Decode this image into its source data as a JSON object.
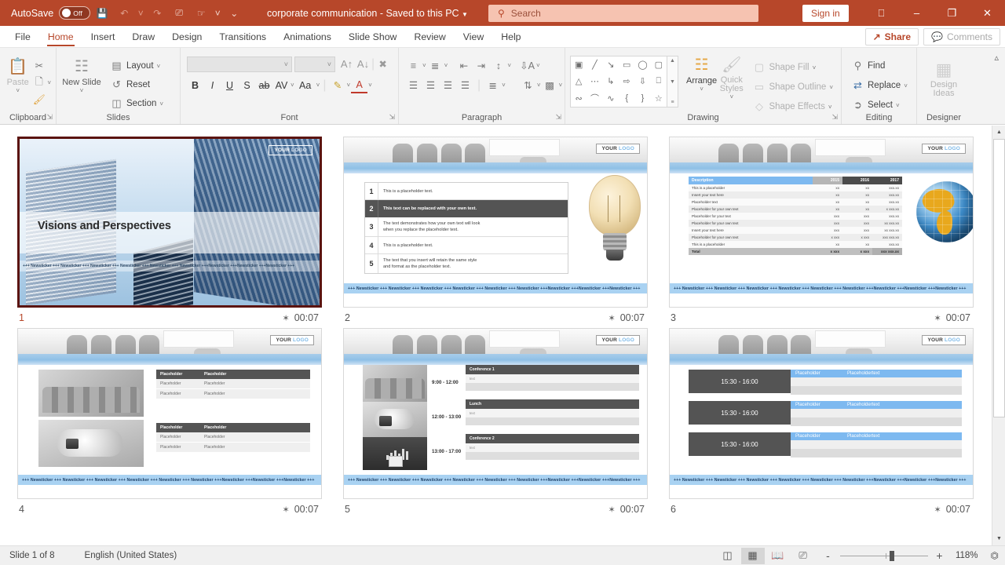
{
  "titlebar": {
    "autosave_label": "AutoSave",
    "autosave_state": "Off",
    "document_title": "corporate communication  -  Saved to this PC",
    "quick_access": [
      "save-icon",
      "undo-icon",
      "redo-icon",
      "start-presentation-icon",
      "touch-mode-icon",
      "customize-qat-icon"
    ],
    "signin_label": "Sign in",
    "window_buttons": [
      "restore-up-icon",
      "minimize",
      "maximize",
      "close"
    ],
    "accent_color": "#b7472a"
  },
  "search": {
    "placeholder": "Search",
    "value": ""
  },
  "tabs": [
    {
      "label": "File",
      "active": false
    },
    {
      "label": "Home",
      "active": true
    },
    {
      "label": "Insert",
      "active": false
    },
    {
      "label": "Draw",
      "active": false
    },
    {
      "label": "Design",
      "active": false
    },
    {
      "label": "Transitions",
      "active": false
    },
    {
      "label": "Animations",
      "active": false
    },
    {
      "label": "Slide Show",
      "active": false
    },
    {
      "label": "Review",
      "active": false
    },
    {
      "label": "View",
      "active": false
    },
    {
      "label": "Help",
      "active": false
    }
  ],
  "tabbar_right": {
    "share_label": "Share",
    "comments_label": "Comments"
  },
  "ribbon": {
    "groups": [
      {
        "name": "Clipboard",
        "label": "Clipboard",
        "has_dialog": true,
        "items": [
          {
            "label": "Paste",
            "icon": "paste-icon",
            "disabled": true
          },
          {
            "label": "Cut",
            "icon": "scissors-icon",
            "disabled": false
          },
          {
            "label": "Copy",
            "icon": "copy-icon",
            "disabled": false
          },
          {
            "label": "Format Painter",
            "icon": "format-painter-icon",
            "disabled": false
          }
        ]
      },
      {
        "name": "Slides",
        "label": "Slides",
        "has_dialog": false,
        "items": [
          {
            "label": "New Slide",
            "icon": "new-slide-icon",
            "disabled": false
          },
          {
            "label": "Layout",
            "icon": "layout-icon",
            "disabled": false
          },
          {
            "label": "Reset",
            "icon": "reset-icon",
            "disabled": false
          },
          {
            "label": "Section",
            "icon": "section-icon",
            "disabled": false
          }
        ]
      },
      {
        "name": "Font",
        "label": "Font",
        "has_dialog": true,
        "font_name": "",
        "font_size": "",
        "items": [
          {
            "label": "Bold",
            "icon": "bold-icon"
          },
          {
            "label": "Italic",
            "icon": "italic-icon"
          },
          {
            "label": "Underline",
            "icon": "underline-icon"
          },
          {
            "label": "Text Shadow",
            "icon": "shadow-icon"
          },
          {
            "label": "Strikethrough",
            "icon": "strikethrough-icon"
          },
          {
            "label": "Character Spacing",
            "icon": "char-spacing-icon"
          },
          {
            "label": "Change Case",
            "icon": "change-case-icon"
          },
          {
            "label": "Text Highlight Color",
            "icon": "highlight-icon"
          },
          {
            "label": "Font Color",
            "icon": "font-color-icon"
          },
          {
            "label": "Increase Font Size",
            "icon": "increase-font-icon"
          },
          {
            "label": "Decrease Font Size",
            "icon": "decrease-font-icon"
          },
          {
            "label": "Clear All Formatting",
            "icon": "clear-formatting-icon"
          }
        ]
      },
      {
        "name": "Paragraph",
        "label": "Paragraph",
        "has_dialog": true,
        "items": [
          {
            "label": "Bullets",
            "icon": "bullets-icon"
          },
          {
            "label": "Numbering",
            "icon": "numbering-icon"
          },
          {
            "label": "Decrease Indent",
            "icon": "decrease-indent-icon"
          },
          {
            "label": "Increase Indent",
            "icon": "increase-indent-icon"
          },
          {
            "label": "Line Spacing",
            "icon": "line-spacing-icon"
          },
          {
            "label": "Align Left",
            "icon": "align-left-icon"
          },
          {
            "label": "Center",
            "icon": "align-center-icon"
          },
          {
            "label": "Align Right",
            "icon": "align-right-icon"
          },
          {
            "label": "Justify",
            "icon": "justify-icon"
          },
          {
            "label": "Columns",
            "icon": "columns-icon"
          },
          {
            "label": "Text Direction",
            "icon": "text-direction-icon"
          },
          {
            "label": "Align Text",
            "icon": "align-text-icon"
          },
          {
            "label": "Convert to SmartArt",
            "icon": "smartart-icon"
          }
        ]
      },
      {
        "name": "Drawing",
        "label": "Drawing",
        "has_dialog": true,
        "items": [
          {
            "label": "Arrange",
            "icon": "arrange-icon",
            "disabled": false
          },
          {
            "label": "Quick Styles",
            "icon": "quick-styles-icon",
            "disabled": true
          },
          {
            "label": "Shape Fill",
            "icon": "shape-fill-icon",
            "disabled": true
          },
          {
            "label": "Shape Outline",
            "icon": "shape-outline-icon",
            "disabled": true
          },
          {
            "label": "Shape Effects",
            "icon": "shape-effects-icon",
            "disabled": true
          }
        ]
      },
      {
        "name": "Editing",
        "label": "Editing",
        "has_dialog": false,
        "items": [
          {
            "label": "Find",
            "icon": "search-icon"
          },
          {
            "label": "Replace",
            "icon": "replace-icon"
          },
          {
            "label": "Select",
            "icon": "select-pointer-icon"
          }
        ]
      },
      {
        "name": "Designer",
        "label": "Designer",
        "has_dialog": false,
        "items": [
          {
            "label": "Design Ideas",
            "icon": "design-ideas-icon",
            "disabled": true
          }
        ]
      }
    ],
    "shape_gallery": [
      "textbox",
      "line",
      "line-arrow",
      "rectangle",
      "oval",
      "rounded-rectangle",
      "triangle",
      "elbow-connector",
      "elbow-arrow-connector",
      "block-arrow-right",
      "block-arrow-down",
      "flowchart-shape",
      "scribble",
      "arc",
      "curve",
      "left-brace",
      "right-brace",
      "star"
    ],
    "collapse_label": "Collapse the Ribbon"
  },
  "slides": [
    {
      "number": "1",
      "timing": "00:07",
      "selected": true,
      "logo": {
        "first": "YOUR",
        "second": "LOGO"
      },
      "title": "Visions and Perspectives",
      "ticker": "+++ Newsticker +++ Newsticker +++ Newsticker +++ Newsticker +++ Newsticker +++ Newsticker +++Newsticker +++Newsticker +++Newsticker +++"
    },
    {
      "number": "2",
      "timing": "00:07",
      "selected": false,
      "logo": {
        "first": "YOUR",
        "second": "LOGO"
      },
      "ticker": "+++ Newsticker +++ Newsticker +++ Newsticker +++ Newsticker +++ Newsticker +++ Newsticker +++Newsticker +++Newsticker +++Newsticker +++",
      "list": [
        {
          "n": "1",
          "lines": [
            "This is a placeholder text."
          ],
          "highlight": false
        },
        {
          "n": "2",
          "lines": [
            "This text can be replaced with your own text."
          ],
          "highlight": true
        },
        {
          "n": "3",
          "lines": [
            "The text demonstrates how your own text will look",
            "when you replace the placeholder text."
          ],
          "highlight": false
        },
        {
          "n": "4",
          "lines": [
            "This is a placeholder text."
          ],
          "highlight": false
        },
        {
          "n": "5",
          "lines": [
            "The text that you insert will retain the same style",
            "and format as the placeholder text."
          ],
          "highlight": false
        }
      ]
    },
    {
      "number": "3",
      "timing": "00:07",
      "selected": false,
      "logo": {
        "first": "YOUR",
        "second": "LOGO"
      },
      "ticker": "+++ Newsticker +++ Newsticker +++ Newsticker +++ Newsticker +++ Newsticker +++ Newsticker +++Newsticker +++Newsticker +++Newsticker +++",
      "table": {
        "headers": [
          "Description",
          "2015",
          "2016",
          "2017"
        ],
        "rows": [
          {
            "label": "This is a placeholder",
            "values": [
              "xx",
              "xx",
              "xxx.xx"
            ]
          },
          {
            "label": "Insert your text here",
            "values": [
              "xx",
              "xx",
              "xxx.xx"
            ]
          },
          {
            "label": "Placeholder text",
            "values": [
              "xx",
              "xx",
              "xxx.xx"
            ]
          },
          {
            "label": "Placeholder for your own text",
            "values": [
              "xx",
              "xx",
              "x xxx.xx"
            ]
          },
          {
            "label": "Placeholder for your text",
            "values": [
              "xxx",
              "xxx",
              "xxx.xx"
            ]
          },
          {
            "label": "Placeholder for your own text",
            "values": [
              "xxx",
              "xxx",
              "xx xxx.xx"
            ]
          },
          {
            "label": "Insert your text here",
            "values": [
              "xxx",
              "xxx",
              "xx xxx.xx"
            ]
          },
          {
            "label": "Placeholder for your own text",
            "values": [
              "x xxx",
              "x xxx",
              "xxx xxx.xx"
            ]
          },
          {
            "label": "This is a placeholder",
            "values": [
              "xx",
              "xx",
              "xxx.xx"
            ]
          }
        ],
        "total": {
          "label": "Total",
          "values": [
            "x xxx",
            "x xxx",
            "xxx xxx.xx"
          ]
        }
      }
    },
    {
      "number": "4",
      "timing": "00:07",
      "selected": false,
      "logo": {
        "first": "YOUR",
        "second": "LOGO"
      },
      "ticker": "+++ Newsticker +++ Newsticker +++ Newsticker +++ Newsticker +++ Newsticker +++ Newsticker +++Newsticker +++Newsticker +++Newsticker +++",
      "tables": [
        {
          "headers": [
            "Placeholder",
            "Placeholder"
          ],
          "rows": [
            [
              "Placeholder",
              "Placeholder"
            ],
            [
              "Placeholder",
              "Placeholder"
            ]
          ]
        },
        {
          "headers": [
            "Placeholder",
            "Placeholder"
          ],
          "rows": [
            [
              "Placeholder",
              "Placeholder"
            ],
            [
              "Placeholder",
              "Placeholder"
            ]
          ]
        }
      ]
    },
    {
      "number": "5",
      "timing": "00:07",
      "selected": false,
      "logo": {
        "first": "YOUR",
        "second": "LOGO"
      },
      "ticker": "+++ Newsticker +++ Newsticker +++ Newsticker +++ Newsticker +++ Newsticker +++ Newsticker +++Newsticker +++Newsticker +++Newsticker +++",
      "agenda": [
        {
          "time": "9:00 - 12:00",
          "title": "Conference 1",
          "text": "text"
        },
        {
          "time": "12:00 - 13:00",
          "title": "Lunch",
          "text": "text"
        },
        {
          "time": "13:00 - 17:00",
          "title": "Conference 2",
          "text": "text"
        }
      ]
    },
    {
      "number": "6",
      "timing": "00:07",
      "selected": false,
      "logo": {
        "first": "YOUR",
        "second": "LOGO"
      },
      "ticker": "+++ Newsticker +++ Newsticker +++ Newsticker +++ Newsticker +++ Newsticker +++ Newsticker +++Newsticker +++Newsticker +++Newsticker +++",
      "blocks": [
        {
          "time": "15:30 - 16:00",
          "col1": "Placeholder",
          "col2": "Placeholdertext"
        },
        {
          "time": "15:30 - 16:00",
          "col1": "Placeholder",
          "col2": "Placeholdertext"
        },
        {
          "time": "15:30 - 16:00",
          "col1": "Placeholder",
          "col2": "Placeholdertext"
        }
      ]
    }
  ],
  "status": {
    "slide_counter": "Slide 1 of 8",
    "language": "English (United States)",
    "views": [
      {
        "name": "normal-view",
        "icon": "normal-view-icon",
        "active": false
      },
      {
        "name": "slide-sorter-view",
        "icon": "slide-sorter-icon",
        "active": true
      },
      {
        "name": "reading-view",
        "icon": "reading-view-icon",
        "active": false
      },
      {
        "name": "slide-show-view",
        "icon": "slide-show-icon",
        "active": false
      }
    ],
    "zoom_value": "118%",
    "zoom_out_label": "-",
    "zoom_in_label": "+",
    "fit_label": "Fit slide to current window"
  }
}
